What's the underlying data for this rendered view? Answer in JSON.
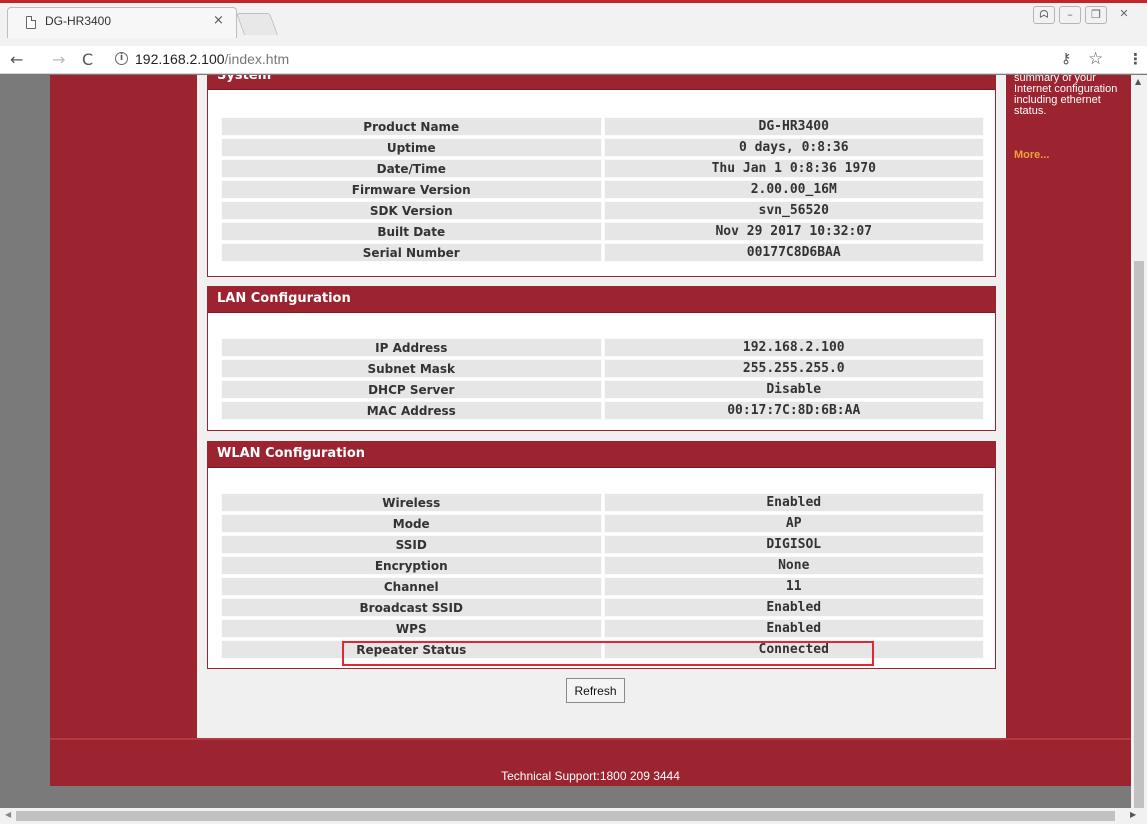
{
  "browser": {
    "tab_title": "DG-HR3400",
    "tab_close": "×",
    "url_host": "192.168.2.100",
    "url_path": "/index.htm",
    "win_controls": [
      "ᗣ",
      "–",
      "❐",
      "✕"
    ]
  },
  "sidebar_right": {
    "help_text": "summary of your Internet configuration including ethernet status.",
    "more_link": "More..."
  },
  "system": {
    "title": "System",
    "rows": [
      {
        "label": "Product Name",
        "value": "DG-HR3400"
      },
      {
        "label": "Uptime",
        "value": "0 days, 0:8:36"
      },
      {
        "label": "Date/Time",
        "value": "Thu Jan 1 0:8:36 1970"
      },
      {
        "label": "Firmware Version",
        "value": "2.00.00_16M"
      },
      {
        "label": "SDK Version",
        "value": "svn_56520"
      },
      {
        "label": "Built Date",
        "value": "Nov 29 2017 10:32:07"
      },
      {
        "label": "Serial Number",
        "value": "00177C8D6BAA"
      }
    ]
  },
  "lan": {
    "title": "LAN Configuration",
    "rows": [
      {
        "label": "IP Address",
        "value": "192.168.2.100"
      },
      {
        "label": "Subnet Mask",
        "value": "255.255.255.0"
      },
      {
        "label": "DHCP Server",
        "value": "Disable"
      },
      {
        "label": "MAC Address",
        "value": "00:17:7C:8D:6B:AA"
      }
    ]
  },
  "wlan": {
    "title": "WLAN Configuration",
    "rows": [
      {
        "label": "Wireless",
        "value": "Enabled"
      },
      {
        "label": "Mode",
        "value": "AP"
      },
      {
        "label": "SSID",
        "value": "DIGISOL"
      },
      {
        "label": "Encryption",
        "value": "None"
      },
      {
        "label": "Channel",
        "value": "11"
      },
      {
        "label": "Broadcast SSID",
        "value": "Enabled"
      },
      {
        "label": "WPS",
        "value": "Enabled"
      },
      {
        "label": "Repeater Status",
        "value": "Connected"
      }
    ]
  },
  "refresh_label": "Refresh",
  "footer_text": "Technical Support:1800 209 3444",
  "colors": {
    "brand_red": "#9b2430",
    "highlight_red": "#e5262f",
    "more_link_orange": "#f0a040"
  }
}
